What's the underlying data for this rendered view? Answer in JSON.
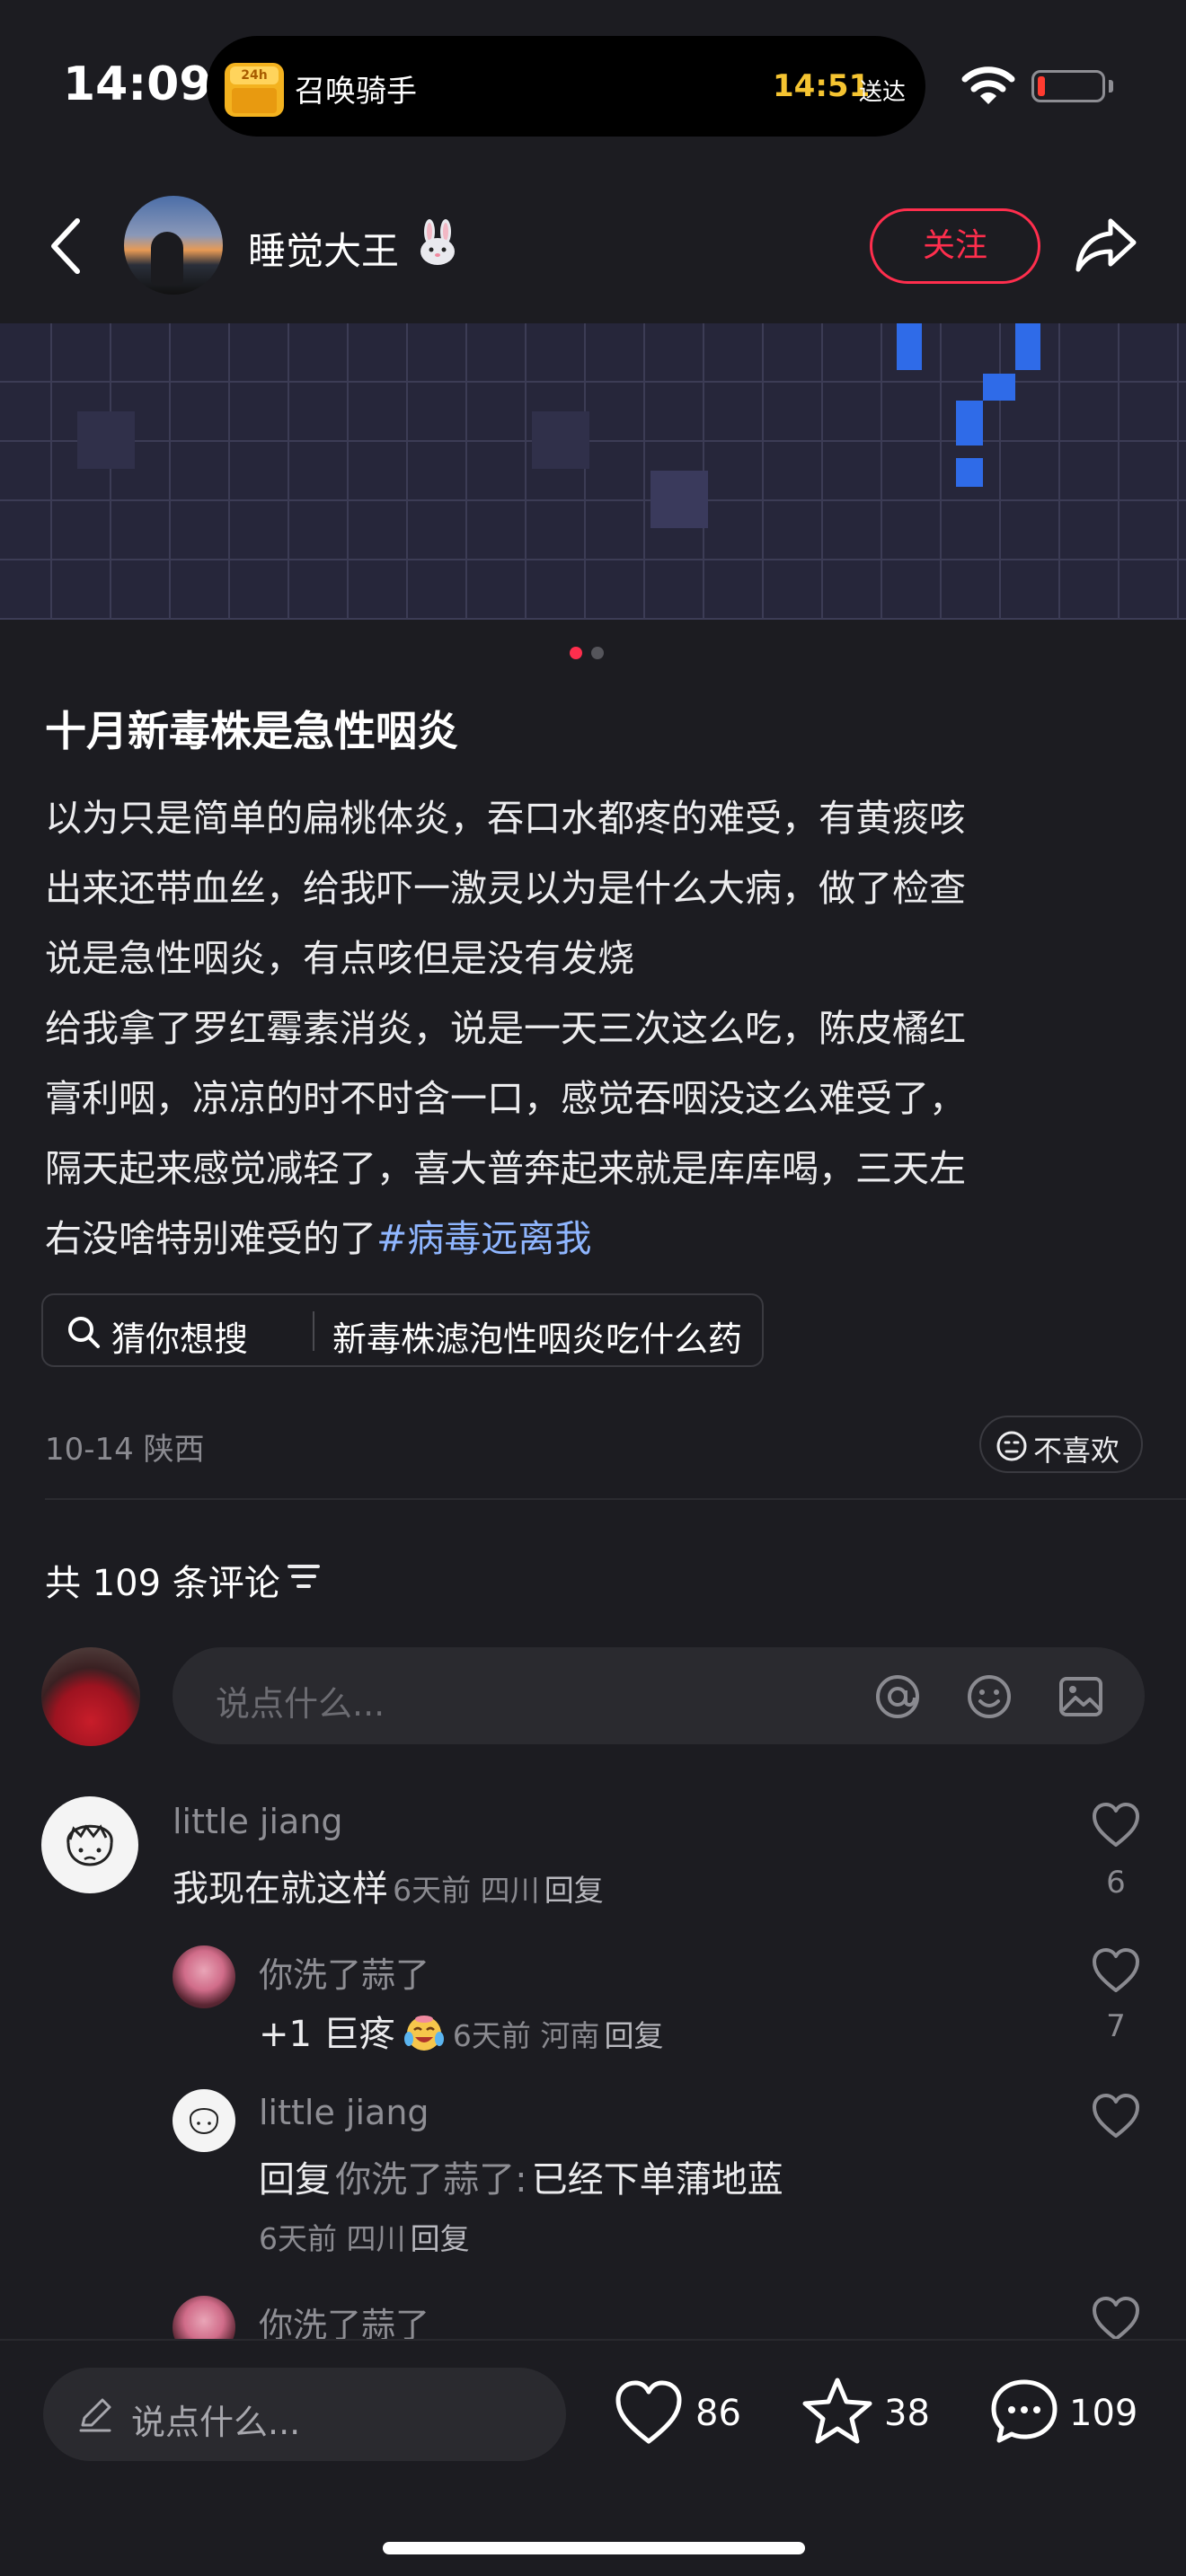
{
  "status_bar": {
    "time": "14:09",
    "island_app_badge": "24h",
    "island_label": "召唤骑手",
    "island_time": "14:51",
    "island_time_suffix": "送达"
  },
  "header": {
    "username": "睡觉大王",
    "follow_label": "关注"
  },
  "carousel": {
    "count": 2,
    "active_index": 0,
    "active_color": "#ff2e4d",
    "inactive_color": "#55555b"
  },
  "post": {
    "title": "十月新毒株是急性咽炎",
    "body": "以为只是简单的扁桃体炎，吞口水都疼的难受，有黄痰咳\n出来还带血丝，给我吓一激灵以为是什么大病，做了检查\n说是急性咽炎，有点咳但是没有发烧\n给我拿了罗红霉素消炎，说是一天三次这么吃，陈皮橘红\n膏利咽，凉凉的时不时含一口，感觉吞咽没这么难受了，\n隔天起来感觉减轻了，喜大普奔起来就是库库喝，三天左\n右没啥特别难受的了",
    "hashtag": "#病毒远离我",
    "search_label": "猜你想搜",
    "search_query": "新毒株滤泡性咽炎吃什么药",
    "date_location": "10-14 陕西",
    "dislike_label": "不喜欢"
  },
  "comments_section": {
    "count_label": "共 109 条评论",
    "input_placeholder": "说点什么..."
  },
  "comments": [
    {
      "name": "little jiang",
      "text": "我现在就这样",
      "meta": "6天前 四川",
      "reply_label": "回复",
      "likes": "6"
    }
  ],
  "replies": [
    {
      "name": "你洗了蒜了",
      "text": "+1 巨疼",
      "meta": "6天前 河南",
      "reply_label": "回复",
      "likes": "7"
    },
    {
      "name": "little jiang",
      "reply_prefix": "回复",
      "reply_to": "你洗了蒜了:",
      "text": "已经下单蒲地蓝",
      "meta": "6天前 四川",
      "reply_label": "回复"
    },
    {
      "name": "你洗了蒜了"
    }
  ],
  "bottom_bar": {
    "input_placeholder": "说点什么...",
    "likes": "86",
    "stars": "38",
    "comments": "109"
  },
  "colors": {
    "background": "#1c1c21",
    "accent_red": "#ff2e4d",
    "hashtag_blue": "#8fb6ff",
    "pixel_blue": "#2f6be8"
  }
}
